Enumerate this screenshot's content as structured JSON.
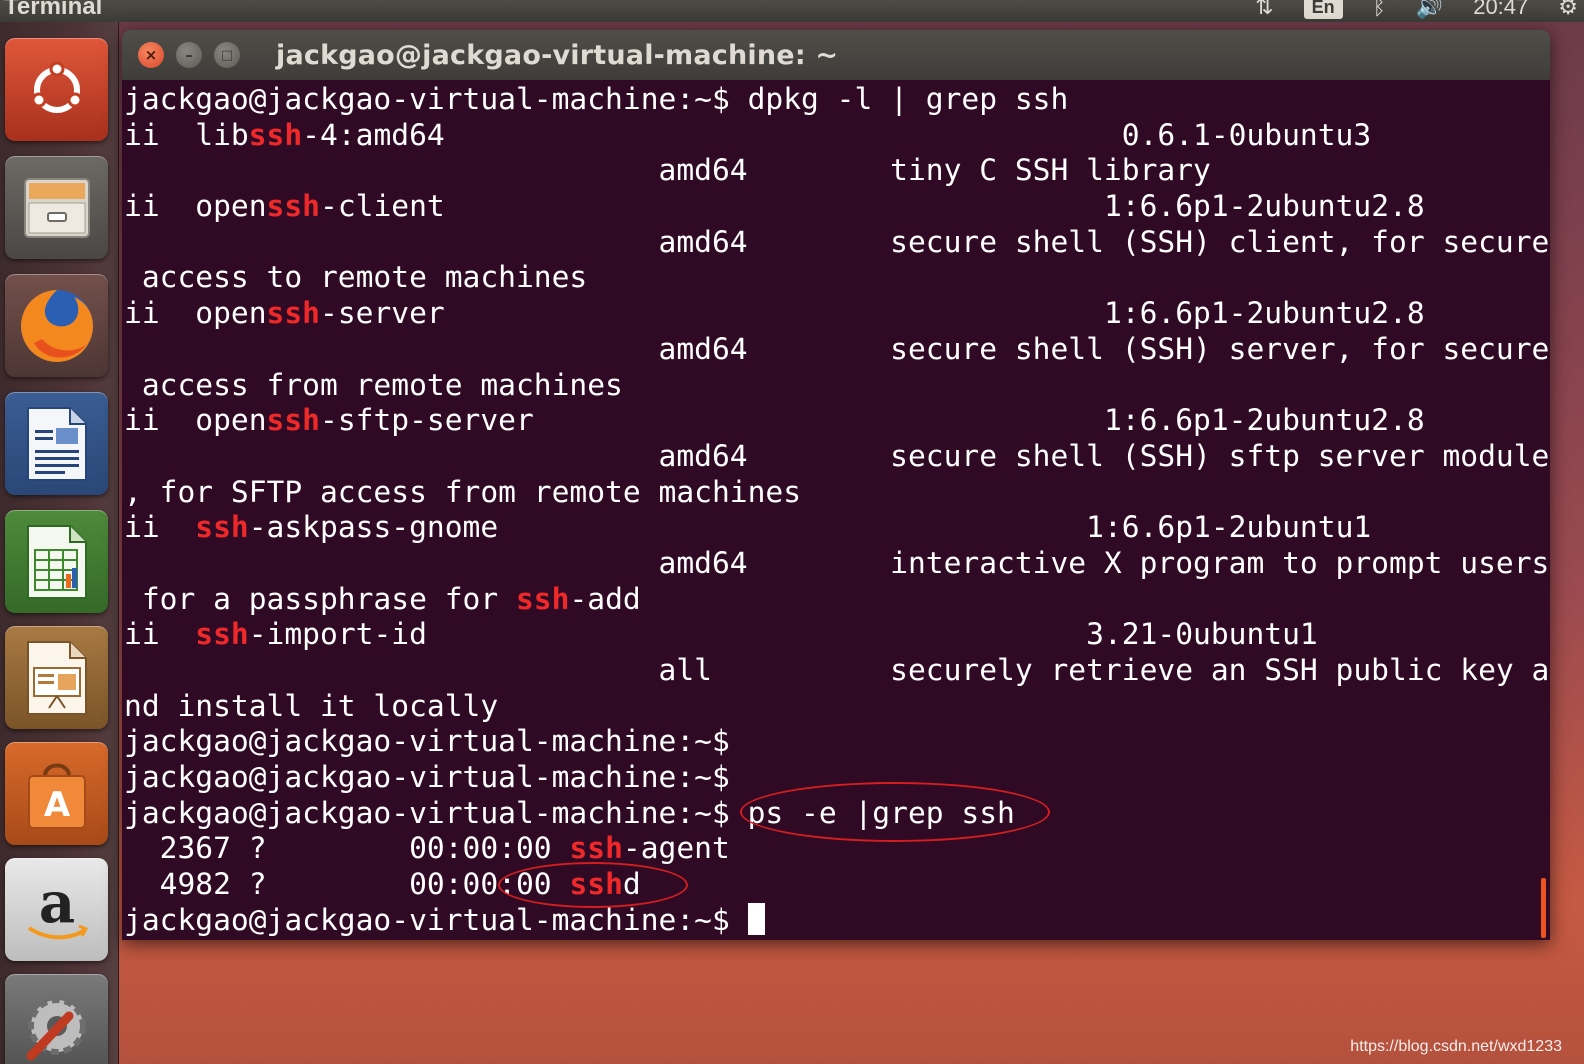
{
  "panel": {
    "app_title": "Terminal",
    "keyboard_indicator": "En",
    "clock": "20:47"
  },
  "launcher": {
    "items": [
      "Ubuntu Dash",
      "Files",
      "Firefox Web Browser",
      "LibreOffice Writer",
      "LibreOffice Calc",
      "LibreOffice Impress",
      "Ubuntu Software Center",
      "Amazon",
      "System Settings"
    ]
  },
  "window": {
    "title": "jackgao@jackgao-virtual-machine: ~"
  },
  "terminal": {
    "lines": [
      [
        {
          "t": "jackgao@jackgao-virtual-machine:~$ dpkg -l | grep ssh"
        }
      ],
      [
        {
          "t": "ii  lib"
        },
        {
          "t": "ssh",
          "hl": true
        },
        {
          "t": "-4:amd64                                      0.6.1-0ubuntu3"
        }
      ],
      [
        {
          "t": "                              amd64        tiny C SSH library"
        }
      ],
      [
        {
          "t": "ii  open"
        },
        {
          "t": "ssh",
          "hl": true
        },
        {
          "t": "-client                                     1:6.6p1-2ubuntu2.8"
        }
      ],
      [
        {
          "t": "                              amd64        secure shell (SSH) client, for secure"
        }
      ],
      [
        {
          "t": " access to remote machines"
        }
      ],
      [
        {
          "t": "ii  open"
        },
        {
          "t": "ssh",
          "hl": true
        },
        {
          "t": "-server                                     1:6.6p1-2ubuntu2.8"
        }
      ],
      [
        {
          "t": "                              amd64        secure shell (SSH) server, for secure"
        }
      ],
      [
        {
          "t": " access from remote machines"
        }
      ],
      [
        {
          "t": "ii  open"
        },
        {
          "t": "ssh",
          "hl": true
        },
        {
          "t": "-sftp-server                                1:6.6p1-2ubuntu2.8"
        }
      ],
      [
        {
          "t": "                              amd64        secure shell (SSH) sftp server module"
        }
      ],
      [
        {
          "t": ", for SFTP access from remote machines"
        }
      ],
      [
        {
          "t": "ii  "
        },
        {
          "t": "ssh",
          "hl": true
        },
        {
          "t": "-askpass-gnome                                 1:6.6p1-2ubuntu1"
        }
      ],
      [
        {
          "t": "                              amd64        interactive X program to prompt users"
        }
      ],
      [
        {
          "t": " for a passphrase for "
        },
        {
          "t": "ssh",
          "hl": true
        },
        {
          "t": "-add"
        }
      ],
      [
        {
          "t": "ii  "
        },
        {
          "t": "ssh",
          "hl": true
        },
        {
          "t": "-import-id                                     3.21-0ubuntu1"
        }
      ],
      [
        {
          "t": "                              all          securely retrieve an SSH public key a"
        }
      ],
      [
        {
          "t": "nd install it locally"
        }
      ],
      [
        {
          "t": "jackgao@jackgao-virtual-machine:~$"
        }
      ],
      [
        {
          "t": "jackgao@jackgao-virtual-machine:~$"
        }
      ],
      [
        {
          "t": "jackgao@jackgao-virtual-machine:~$ ps -e |grep ssh"
        }
      ],
      [
        {
          "t": "  2367 ?        00:00:00 "
        },
        {
          "t": "ssh",
          "hl": true
        },
        {
          "t": "-agent"
        }
      ],
      [
        {
          "t": "  4982 ?        00:00:00 "
        },
        {
          "t": "ssh",
          "hl": true
        },
        {
          "t": "d"
        }
      ],
      [
        {
          "t": "jackgao@jackgao-virtual-machine:~$ "
        }
      ]
    ]
  },
  "watermark": "https://blog.csdn.net/wxd1233",
  "colors": {
    "terminal_bg": "#300a24",
    "highlight": "#ef2929",
    "annotation": "#d21e1e"
  }
}
